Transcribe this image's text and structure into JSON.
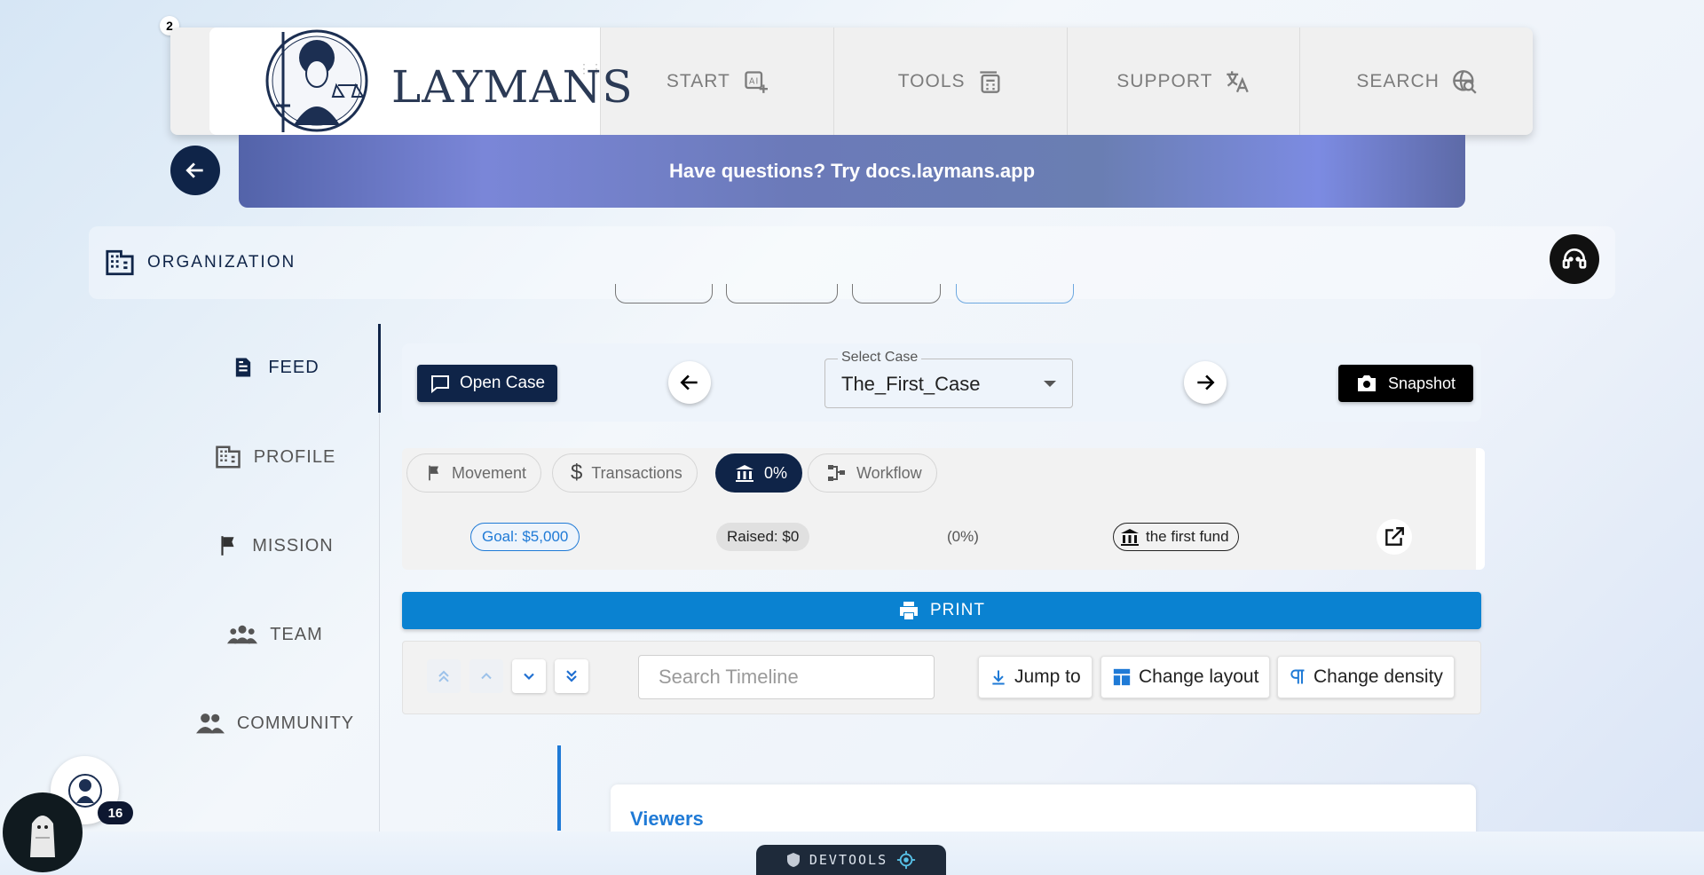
{
  "top_badge": "2",
  "header": {
    "brand": "LAYMANS",
    "nav": [
      {
        "label": "START",
        "icon": "ai-image-icon"
      },
      {
        "label": "TOOLS",
        "icon": "calculator-icon"
      },
      {
        "label": "SUPPORT",
        "icon": "translate-icon"
      },
      {
        "label": "SEARCH",
        "icon": "search-globe-icon"
      }
    ]
  },
  "banner": {
    "text": "Have questions? Try docs.laymans.app"
  },
  "org": {
    "label": "ORGANIZATION"
  },
  "sidebar": {
    "items": [
      {
        "label": "FEED",
        "icon": "document-icon"
      },
      {
        "label": "PROFILE",
        "icon": "building-icon"
      },
      {
        "label": "MISSION",
        "icon": "flag-icon"
      },
      {
        "label": "TEAM",
        "icon": "group-icon"
      },
      {
        "label": "COMMUNITY",
        "icon": "people-icon"
      }
    ]
  },
  "case_bar": {
    "open_case": "Open Case",
    "select_label": "Select Case",
    "select_value": "The_First_Case",
    "snapshot": "Snapshot"
  },
  "fund": {
    "tabs": [
      {
        "label": "Movement"
      },
      {
        "label": "Transactions"
      },
      {
        "label": "0%"
      },
      {
        "label": "Workflow"
      }
    ],
    "goal": "Goal: $5,000",
    "raised": "Raised: $0",
    "percent": "(0%)",
    "fund_name": "the first fund"
  },
  "print": {
    "label": "PRINT"
  },
  "timeline": {
    "search_placeholder": "Search Timeline",
    "jump_to": "Jump to",
    "change_layout": "Change layout",
    "change_density": "Change density"
  },
  "card": {
    "title": "Viewers"
  },
  "notifications": {
    "count": "16"
  },
  "devtools": {
    "label": "DEVTOOLS"
  },
  "colors": {
    "primary": "#0f2448",
    "accent": "#0a82d1",
    "link": "#1f7ad6"
  }
}
